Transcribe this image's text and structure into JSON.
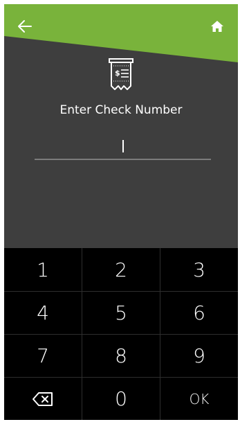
{
  "colors": {
    "accent": "#79b33b",
    "background": "#3e3e3e",
    "keypad": "#000000",
    "text": "#ffffff"
  },
  "header": {
    "back_icon": "arrow-left-icon",
    "home_icon": "home-icon"
  },
  "check": {
    "icon": "receipt-dollar-icon",
    "prompt": "Enter Check Number",
    "value": ""
  },
  "keypad": {
    "keys": [
      "1",
      "2",
      "3",
      "4",
      "5",
      "6",
      "7",
      "8",
      "9"
    ],
    "zero": "0",
    "ok": "OK",
    "backspace_icon": "backspace-icon"
  }
}
